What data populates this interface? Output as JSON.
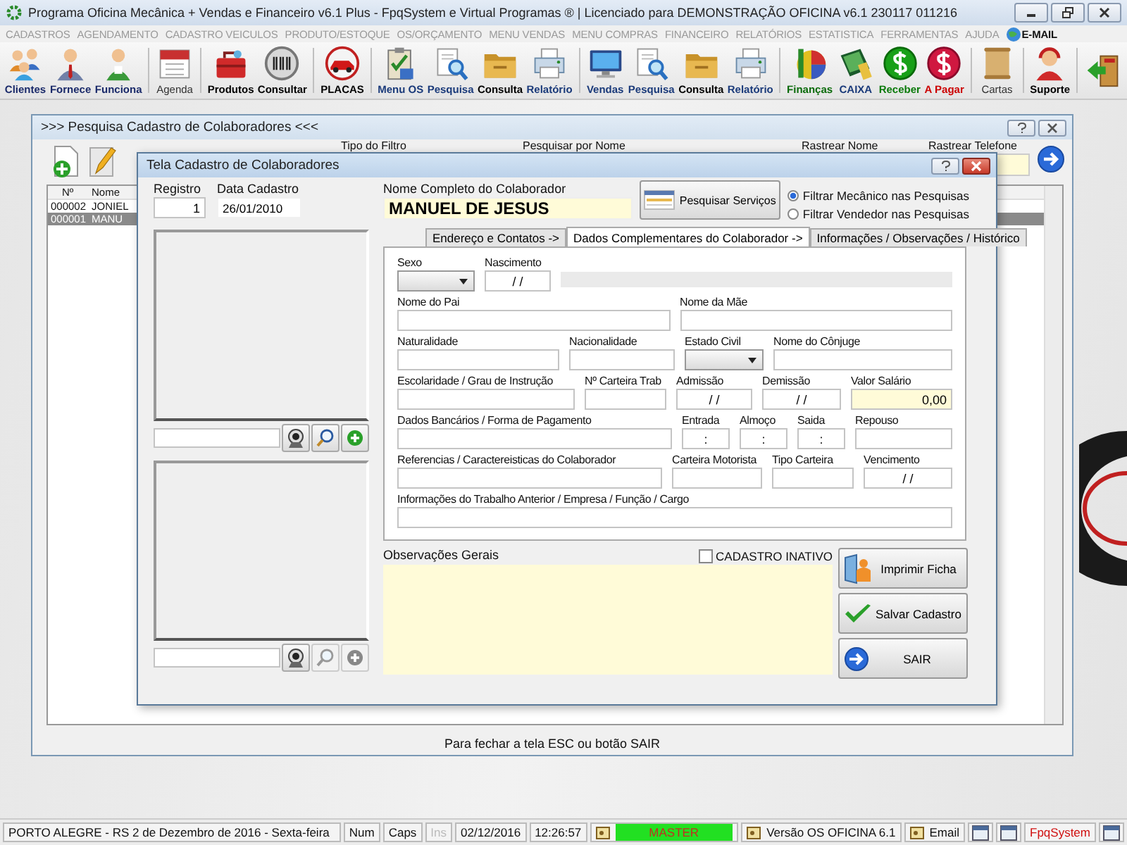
{
  "app": {
    "title": "Programa Oficina Mecânica + Vendas e Financeiro v6.1 Plus - FpqSystem e Virtual Programas ® | Licenciado para  DEMONSTRAÇÃO OFICINA v6.1 230117 011216"
  },
  "menu": [
    {
      "label": "CADASTROS",
      "disabled": true
    },
    {
      "label": "AGENDAMENTO",
      "disabled": true
    },
    {
      "label": "CADASTRO VEICULOS",
      "disabled": true
    },
    {
      "label": "PRODUTO/ESTOQUE",
      "disabled": true
    },
    {
      "label": "OS/ORÇAMENTO",
      "disabled": true
    },
    {
      "label": "MENU VENDAS",
      "disabled": true
    },
    {
      "label": "MENU COMPRAS",
      "disabled": true
    },
    {
      "label": "FINANCEIRO",
      "disabled": true
    },
    {
      "label": "RELATÓRIOS",
      "disabled": true
    },
    {
      "label": "ESTATISTICA",
      "disabled": true
    },
    {
      "label": "FERRAMENTAS",
      "disabled": true
    },
    {
      "label": "AJUDA",
      "disabled": true
    },
    {
      "label": "E-MAIL",
      "disabled": false
    }
  ],
  "toolbar": [
    [
      {
        "label": "Clientes",
        "color": "#1a2a6a",
        "bold": true
      },
      {
        "label": "Fornece",
        "color": "#1a2a6a",
        "bold": true
      },
      {
        "label": "Funciona",
        "color": "#1a2a6a",
        "bold": true
      }
    ],
    [
      {
        "label": "Agenda",
        "color": "#333333",
        "bold": false
      }
    ],
    [
      {
        "label": "Produtos",
        "color": "#000000",
        "bold": true
      },
      {
        "label": "Consultar",
        "color": "#000000",
        "bold": true
      }
    ],
    [
      {
        "label": "PLACAS",
        "color": "#000000",
        "bold": true
      }
    ],
    [
      {
        "label": "Menu OS",
        "color": "#1a3a7a",
        "bold": true
      },
      {
        "label": "Pesquisa",
        "color": "#1a3a7a",
        "bold": true
      },
      {
        "label": "Consulta",
        "color": "#000000",
        "bold": true
      },
      {
        "label": "Relatório",
        "color": "#1a3a7a",
        "bold": true
      }
    ],
    [
      {
        "label": "Vendas",
        "color": "#1a3a7a",
        "bold": true
      },
      {
        "label": "Pesquisa",
        "color": "#1a3a7a",
        "bold": true
      },
      {
        "label": "Consulta",
        "color": "#000000",
        "bold": true
      },
      {
        "label": "Relatório",
        "color": "#1a3a7a",
        "bold": true
      }
    ],
    [
      {
        "label": "Finanças",
        "color": "#0a6a0a",
        "bold": true
      },
      {
        "label": "CAIXA",
        "color": "#1a3a7a",
        "bold": true
      },
      {
        "label": "Receber",
        "color": "#0a7a0a",
        "bold": true
      },
      {
        "label": "A Pagar",
        "color": "#cc0000",
        "bold": true
      }
    ],
    [
      {
        "label": "Cartas",
        "color": "#333333",
        "bold": false
      }
    ],
    [
      {
        "label": "Suporte",
        "color": "#000000",
        "bold": true
      }
    ]
  ],
  "search_window": {
    "title": ">>> Pesquisa Cadastro de Colaboradores <<<",
    "filter_labels": [
      "Tipo do Filtro",
      "Pesquisar por Nome",
      "Rastrear Nome",
      "Rastrear Telefone"
    ],
    "list": {
      "columns": [
        "Nº",
        "Nome"
      ],
      "rows": [
        {
          "cells": [
            "000002",
            "JONIEL"
          ],
          "selected": false
        },
        {
          "cells": [
            "000001",
            "MANU"
          ],
          "selected": true
        }
      ]
    },
    "hint": "Para fechar a tela ESC ou botão SAIR"
  },
  "dialog": {
    "title": "Tela Cadastro de Colaboradores",
    "registro": {
      "label": "Registro",
      "value": "1"
    },
    "data_cadastro": {
      "label": "Data Cadastro",
      "value": "26/01/2010"
    },
    "photo_panels": [
      {
        "buttons": [
          {
            "kind": "camera",
            "disabled": false
          },
          {
            "kind": "search",
            "disabled": false
          },
          {
            "kind": "add",
            "disabled": false
          }
        ]
      },
      {
        "buttons": [
          {
            "kind": "camera",
            "disabled": false
          },
          {
            "kind": "search",
            "disabled": true
          },
          {
            "kind": "add",
            "disabled": true
          }
        ]
      }
    ],
    "nome": {
      "label": "Nome Completo do Colaborador",
      "value": "MANUEL DE JESUS"
    },
    "search_button": "Pesquisar Serviços",
    "filters": [
      {
        "label": "Filtrar Mecânico nas Pesquisas",
        "selected": true
      },
      {
        "label": "Filtrar Vendedor nas Pesquisas",
        "selected": false
      }
    ],
    "tabs": [
      {
        "label": "Endereço e Contatos ->",
        "selected": false
      },
      {
        "label": "Dados Complementares do Colaborador ->",
        "selected": true
      },
      {
        "label": "Informações / Observações / Histórico",
        "selected": false
      }
    ],
    "form_rows": [
      [
        {
          "kind": "combo",
          "label": "Sexo"
        },
        {
          "kind": "date",
          "label": "Nascimento",
          "value": "/ /"
        },
        {
          "kind": "bar"
        }
      ],
      [
        {
          "kind": "text",
          "label": "Nome do Pai"
        },
        {
          "kind": "text",
          "label": "Nome da Mãe"
        }
      ],
      [
        {
          "kind": "text",
          "label": "Naturalidade"
        },
        {
          "kind": "text",
          "label": "Nacionalidade"
        },
        {
          "kind": "combo",
          "label": "Estado Civil"
        },
        {
          "kind": "text",
          "label": "Nome do Cônjuge"
        }
      ],
      [
        {
          "kind": "text",
          "label": "Escolaridade / Grau de Instrução"
        },
        {
          "kind": "text",
          "label": "Nº Carteira Trab"
        },
        {
          "kind": "date",
          "label": "Admissão",
          "value": "/ /"
        },
        {
          "kind": "date",
          "label": "Demissão",
          "value": "/ /"
        },
        {
          "kind": "money",
          "label": "Valor Salário",
          "value": "0,00"
        }
      ],
      [
        {
          "kind": "text",
          "label": "Dados Bancários / Forma de Pagamento"
        },
        {
          "kind": "date",
          "label": "Entrada",
          "value": ":"
        },
        {
          "kind": "date",
          "label": "Almoço",
          "value": ":"
        },
        {
          "kind": "date",
          "label": "Saida",
          "value": ":"
        },
        {
          "kind": "text",
          "label": "Repouso"
        }
      ],
      [
        {
          "kind": "text",
          "label": "Referencias / Caractereisticas do Colaborador"
        },
        {
          "kind": "text",
          "label": "Carteira Motorista"
        },
        {
          "kind": "text",
          "label": "Tipo Carteira"
        },
        {
          "kind": "date",
          "label": "Vencimento",
          "value": "/ /"
        }
      ],
      [
        {
          "kind": "text",
          "label": "Informações do Trabalho Anterior / Empresa / Função / Cargo"
        }
      ]
    ],
    "obs_label": "Observações Gerais",
    "inactive": {
      "label": "CADASTRO INATIVO",
      "checked": false
    },
    "buttons": [
      {
        "kind": "print",
        "label": "Imprimir Ficha"
      },
      {
        "kind": "save",
        "label": "Salvar Cadastro"
      },
      {
        "kind": "exit",
        "label": "SAIR"
      }
    ]
  },
  "status_bar": [
    {
      "kind": "text",
      "text": "PORTO ALEGRE - RS  2 de Dezembro de 2016 - Sexta-feira"
    },
    {
      "kind": "text",
      "text": "Num"
    },
    {
      "kind": "text",
      "text": "Caps"
    },
    {
      "kind": "disabled",
      "text": "Ins"
    },
    {
      "kind": "text",
      "text": "02/12/2016"
    },
    {
      "kind": "text",
      "text": "12:26:57"
    },
    {
      "kind": "badge",
      "text": "MASTER"
    },
    {
      "kind": "icon_text",
      "text": "Versão OS OFICINA 6.1"
    },
    {
      "kind": "icon_text",
      "text": "Email"
    },
    {
      "kind": "icon"
    },
    {
      "kind": "icon"
    },
    {
      "kind": "brand",
      "text": "FpqSystem"
    },
    {
      "kind": "icon"
    }
  ]
}
